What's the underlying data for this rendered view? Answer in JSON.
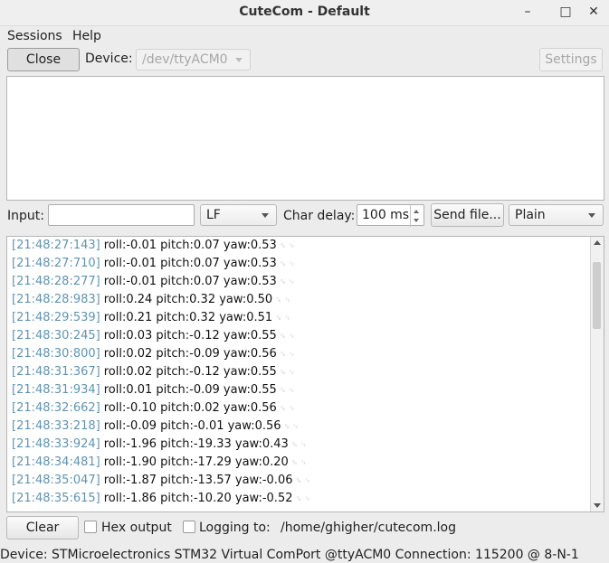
{
  "window": {
    "title": "CuteCom - Default"
  },
  "menu": {
    "sessions": "Sessions",
    "help": "Help"
  },
  "toolbar": {
    "close_label": "Close",
    "device_label": "Device:",
    "device_value": "/dev/ttyACM0",
    "settings_label": "Settings"
  },
  "input_bar": {
    "input_label": "Input:",
    "input_value": "",
    "line_ending": "LF",
    "char_delay_label": "Char delay:",
    "char_delay_value": "100 ms",
    "send_file_label": "Send file...",
    "format": "Plain"
  },
  "log": [
    {
      "ts": "[21:48:27:143]",
      "msg": "roll:-0.01  pitch:0.07  yaw:0.53"
    },
    {
      "ts": "[21:48:27:710]",
      "msg": "roll:-0.01  pitch:0.07  yaw:0.53"
    },
    {
      "ts": "[21:48:28:277]",
      "msg": "roll:-0.01  pitch:0.07  yaw:0.53"
    },
    {
      "ts": "[21:48:28:983]",
      "msg": "roll:0.24  pitch:0.32  yaw:0.50"
    },
    {
      "ts": "[21:48:29:539]",
      "msg": "roll:0.21  pitch:0.32  yaw:0.51"
    },
    {
      "ts": "[21:48:30:245]",
      "msg": "roll:0.03  pitch:-0.12  yaw:0.55"
    },
    {
      "ts": "[21:48:30:800]",
      "msg": "roll:0.02  pitch:-0.09  yaw:0.56"
    },
    {
      "ts": "[21:48:31:367]",
      "msg": "roll:0.02  pitch:-0.12  yaw:0.55"
    },
    {
      "ts": "[21:48:31:934]",
      "msg": "roll:0.01  pitch:-0.09  yaw:0.55"
    },
    {
      "ts": "[21:48:32:662]",
      "msg": "roll:-0.10  pitch:0.02  yaw:0.56"
    },
    {
      "ts": "[21:48:33:218]",
      "msg": "roll:-0.09  pitch:-0.01  yaw:0.56"
    },
    {
      "ts": "[21:48:33:924]",
      "msg": "roll:-1.96  pitch:-19.33  yaw:0.43"
    },
    {
      "ts": "[21:48:34:481]",
      "msg": "roll:-1.90  pitch:-17.29  yaw:0.20"
    },
    {
      "ts": "[21:48:35:047]",
      "msg": "roll:-1.87  pitch:-13.57  yaw:-0.06"
    },
    {
      "ts": "[21:48:35:615]",
      "msg": "roll:-1.86  pitch:-10.20  yaw:-0.52"
    }
  ],
  "bottom_bar": {
    "clear_label": "Clear",
    "hex_output_label": "Hex output",
    "logging_label": "Logging to:",
    "log_path": "/home/ghigher/cutecom.log"
  },
  "status": {
    "device": "Device:  STMicroelectronics STM32 Virtual ComPort @ttyACM0  Connection:  115200 @ 8-N-1"
  }
}
